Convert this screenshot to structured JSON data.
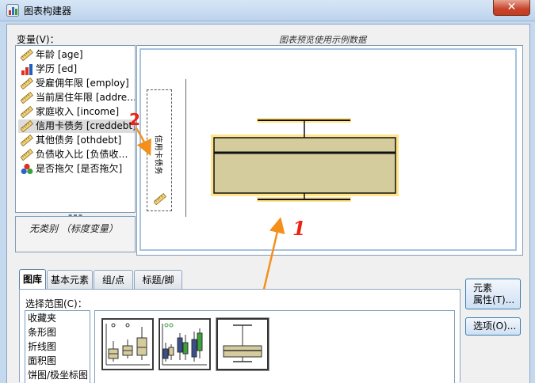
{
  "window": {
    "title": "图表构建器",
    "close_glyph": "✕"
  },
  "variables": {
    "label": "变量(V)：",
    "items": [
      {
        "label": "年龄 [age]",
        "icon": "ruler-scale-icon"
      },
      {
        "label": "学历 [ed]",
        "icon": "ordinal-bars-icon"
      },
      {
        "label": "受雇佣年限 [employ]",
        "icon": "ruler-scale-icon"
      },
      {
        "label": "当前居住年限 [addre…",
        "icon": "ruler-scale-icon"
      },
      {
        "label": "家庭收入 [income]",
        "icon": "ruler-scale-icon"
      },
      {
        "label": "信用卡债务 [creddebt]",
        "icon": "ruler-scale-icon",
        "selected": true
      },
      {
        "label": "其他债务 [othdebt]",
        "icon": "ruler-scale-icon"
      },
      {
        "label": "负债收入比 [负债收…",
        "icon": "ruler-scale-icon"
      },
      {
        "label": "是否拖欠 [是否拖欠]",
        "icon": "nominal-balls-icon"
      }
    ],
    "no_category_text": "无类别 （标度变量）"
  },
  "preview": {
    "caption": "图表预览使用示例数据",
    "y_axis_label": "信用卡债务",
    "annotations": {
      "one": "1",
      "two": "2"
    }
  },
  "tabs": [
    {
      "label": "图库",
      "active": true
    },
    {
      "label": "基本元素"
    },
    {
      "label": "组/点 ID"
    },
    {
      "label": "标题/脚注"
    }
  ],
  "gallery": {
    "select_label": "选择范围(C)：",
    "items": [
      "收藏夹",
      "条形图",
      "折线图",
      "面积图",
      "饼图/极坐标图"
    ],
    "thumbnails": [
      {
        "name": "simple-boxplot-thumbnail"
      },
      {
        "name": "clustered-boxplot-thumbnail"
      },
      {
        "name": "1d-boxplot-thumbnail",
        "selected": true
      }
    ]
  },
  "buttons": {
    "element_props_line1": "元素",
    "element_props_line2": "属性(T)...",
    "options": "选项(O)..."
  },
  "colors": {
    "box_fill": "#d4cc9c",
    "highlight": "#ffe48a",
    "annotation_arrow": "#f4901a",
    "annotation_text": "#e21111"
  }
}
